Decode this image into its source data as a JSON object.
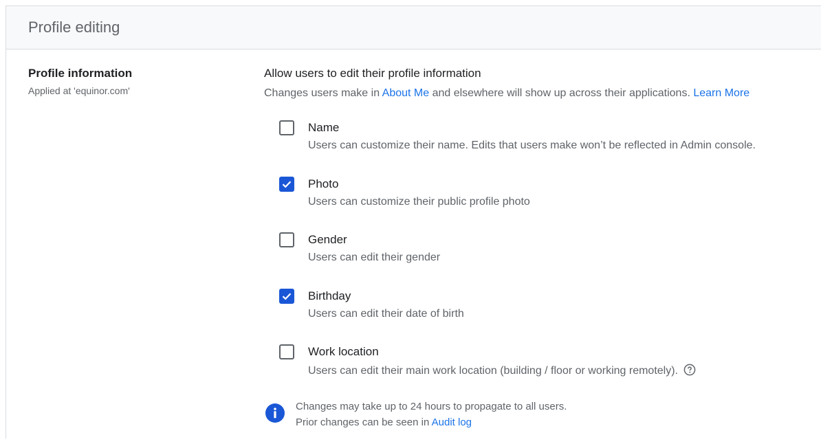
{
  "header": {
    "title": "Profile editing"
  },
  "left": {
    "title": "Profile information",
    "subtitle": "Applied at 'equinor.com'"
  },
  "right": {
    "title": "Allow users to edit their profile information",
    "desc_prefix": "Changes users make in ",
    "desc_link": "About Me",
    "desc_middle": " and elsewhere will show up across their applications. ",
    "desc_learn_more": "Learn More"
  },
  "options": [
    {
      "label": "Name",
      "desc": "Users can customize their name. Edits that users make won’t be reflected in Admin console.",
      "checked": false
    },
    {
      "label": "Photo",
      "desc": "Users can customize their public profile photo",
      "checked": true
    },
    {
      "label": "Gender",
      "desc": "Users can edit their gender",
      "checked": false
    },
    {
      "label": "Birthday",
      "desc": "Users can edit their date of birth",
      "checked": true
    },
    {
      "label": "Work location",
      "desc": "Users can edit their main work location (building / floor or working remotely).",
      "checked": false
    }
  ],
  "notice": {
    "line1": "Changes may take up to 24 hours to propagate to all users.",
    "line2_prefix": "Prior changes can be seen in ",
    "line2_link": "Audit log"
  },
  "colors": {
    "accent": "#1a57d6",
    "link": "#1a73e8",
    "text": "#202124",
    "muted": "#5f6368"
  },
  "icons": {
    "check": "check-icon",
    "info": "info-icon",
    "help": "help-circle-icon"
  }
}
